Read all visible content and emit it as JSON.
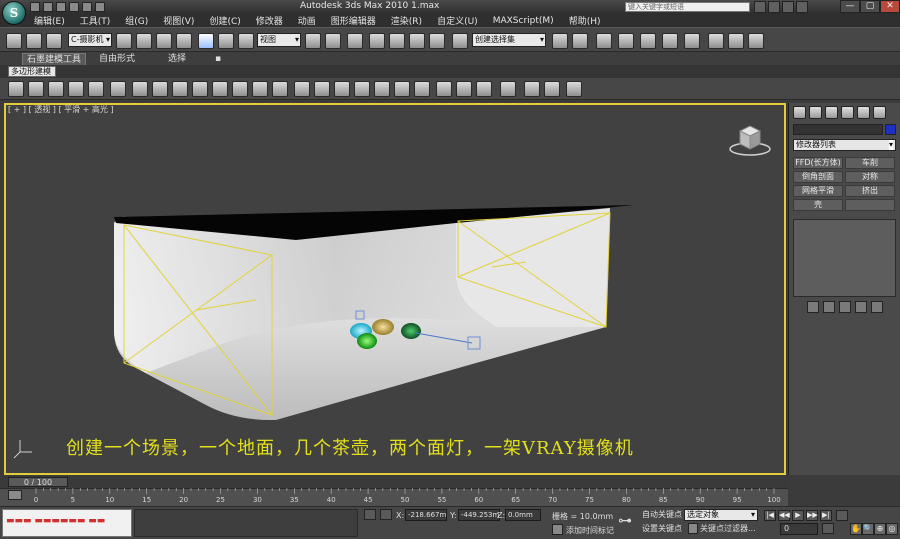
{
  "window": {
    "title": "Autodesk 3ds Max  2010      1.max",
    "logo_glyph": "S",
    "search_placeholder": "键入关键字或短语",
    "controls": [
      "—",
      "▢",
      "✕"
    ]
  },
  "menu": [
    "编辑(E)",
    "工具(T)",
    "组(G)",
    "视图(V)",
    "创建(C)",
    "修改器",
    "动画",
    "图形编辑器",
    "渲染(R)",
    "自定义(U)",
    "MAXScript(M)",
    "帮助(H)"
  ],
  "toolbar": {
    "filter_value": "C-摄影机",
    "refcoord_value": "视图",
    "named_selection_value": "创建选择集"
  },
  "ribbon": {
    "tabs": [
      "石墨建模工具",
      "自由形式",
      "选择"
    ],
    "subtab": "多边形建模"
  },
  "viewport": {
    "label": "[ + ] [ 透视 ] [ 平滑 + 高光 ]",
    "active_border_color": "#e5cc3a"
  },
  "caption": "创建一个场景，一个地面，几个茶壶，两个面灯，一架VRAY摄像机",
  "command_panel": {
    "modifier_list": "修改器列表",
    "buttons": [
      "FFD(长方体)",
      "车削",
      "倒角剖面",
      "对称",
      "网格平滑",
      "挤出",
      "壳",
      ""
    ],
    "object_color": "#1f2fc4"
  },
  "timeline": {
    "slider": "0 / 100",
    "ticks": [
      "0",
      "5",
      "10",
      "15",
      "20",
      "25",
      "30",
      "35",
      "40",
      "45",
      "50",
      "55",
      "60",
      "65",
      "70",
      "75",
      "80",
      "85",
      "90",
      "95",
      "100"
    ]
  },
  "status": {
    "maxscript_text": "▬▬▬ ▬▬▬▬▬▬ ▬▬",
    "x_label": "X:",
    "x_value": "-218.667m",
    "y_label": "Y:",
    "y_value": "-449.253m",
    "z_label": "Z:",
    "z_value": "0.0mm",
    "grid": "栅格 = 10.0mm",
    "add_time_tag": "添加时间标记",
    "auto_key": "自动关键点",
    "set_key": "设置关键点",
    "selection_mode": "选定对象",
    "key_filters": "关键点过滤器...",
    "frame": "0",
    "playback": [
      "|◀",
      "◀◀",
      "▶",
      "▶▶",
      "▶|"
    ],
    "nav": [
      "✋",
      "🔍",
      "⊕",
      "◎"
    ]
  }
}
